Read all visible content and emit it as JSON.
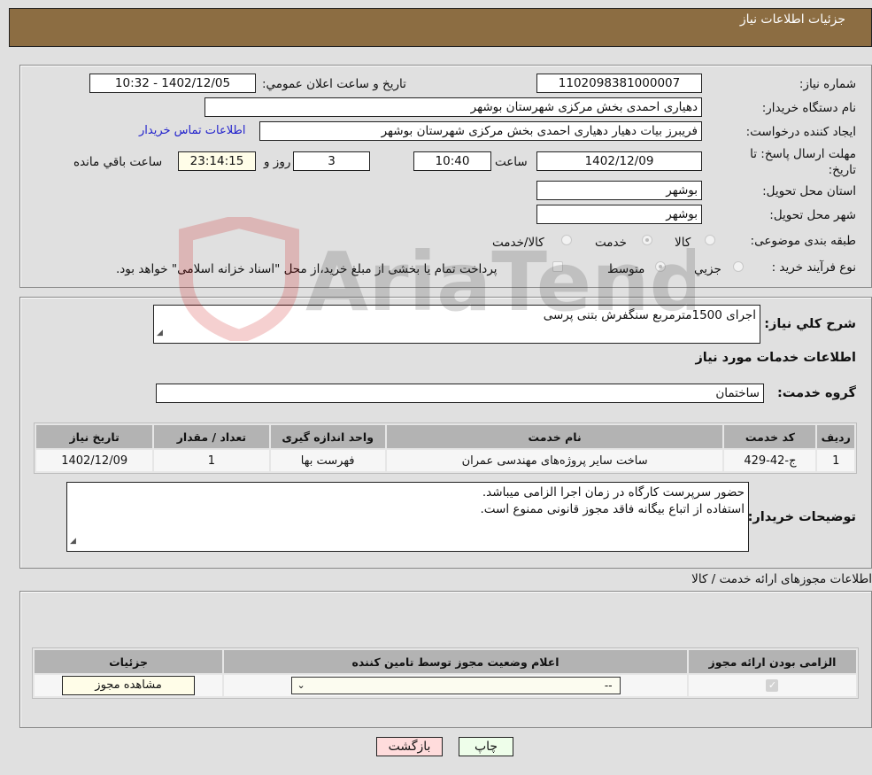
{
  "header": {
    "title": "جزئیات اطلاعات نیاز"
  },
  "form": {
    "need_number_label": "شماره نیاز:",
    "need_number": "1102098381000007",
    "announce_label": "تاریخ و ساعت اعلان عمومي:",
    "announce_value": "1402/12/05 - 10:32",
    "buyer_org_label": "نام دستگاه خریدار:",
    "buyer_org": "دهیاری احمدی بخش مرکزی شهرستان بوشهر",
    "requester_label": "ایجاد کننده درخواست:",
    "requester": "فریبرز بیات دهیار دهیاری احمدی بخش مرکزی شهرستان بوشهر",
    "buyer_contact_link": "اطلاعات تماس خریدار",
    "deadline_label": "مهلت ارسال پاسخ: تا تاریخ:",
    "deadline_date": "1402/12/09",
    "time_label": "ساعت",
    "deadline_time": "10:40",
    "days_value": "3",
    "days_label": "روز و",
    "remaining_time": "23:14:15",
    "remaining_label": "ساعت باقي مانده",
    "province_label": "استان محل تحویل:",
    "province": "بوشهر",
    "city_label": "شهر محل تحویل:",
    "city": "بوشهر",
    "category_label": "طبقه بندی موضوعی:",
    "category_options": [
      {
        "label": "کالا",
        "checked": false
      },
      {
        "label": "خدمت",
        "checked": true
      },
      {
        "label": "کالا/خدمت",
        "checked": false
      }
    ],
    "process_label": "نوع فرآیند خرید :",
    "process_options": [
      {
        "label": "جزیي",
        "checked": false
      },
      {
        "label": "متوسط",
        "checked": true
      }
    ],
    "treasury_checkbox_label": "پرداخت تمام یا بخشی از مبلغ خرید،از محل \"اسناد خزانه اسلامی\" خواهد بود.",
    "treasury_checked": false
  },
  "services": {
    "summary_label": "شرح کلي نیاز:",
    "summary": "اجرای 1500مترمربع سنگفرش بتنی پرسی",
    "section_title": "اطلاعات خدمات مورد نیاز",
    "group_label": "گروه خدمت:",
    "group": "ساختمان",
    "table": {
      "headers": [
        "ردیف",
        "کد خدمت",
        "نام خدمت",
        "واحد اندازه گیری",
        "تعداد / مقدار",
        "تاریخ نیاز"
      ],
      "rows": [
        [
          "1",
          "ج-42-429",
          "ساخت سایر پروژه‌های مهندسی عمران",
          "فهرست بها",
          "1",
          "1402/12/09"
        ]
      ]
    },
    "buyer_notes_label": "توضیحات خریدار:",
    "buyer_notes_lines": [
      "حضور سرپرست کارگاه در زمان اجرا الزامی میباشد.",
      "استفاده از اتباع بیگانه فاقد مجوز قانونی ممنوع است."
    ]
  },
  "permits": {
    "section_title": "اطلاعات مجوزهای ارائه خدمت / کالا",
    "headers": [
      "الزامی بودن ارائه مجوز",
      "اعلام وضعیت مجوز توسط تامین کننده",
      "جزئیات"
    ],
    "row": {
      "required_checked": true,
      "status_selected": "--",
      "view_button": "مشاهده مجوز"
    }
  },
  "actions": {
    "print": "چاپ",
    "back": "بازگشت"
  },
  "watermark": {
    "text": "AriaTender.neT"
  }
}
